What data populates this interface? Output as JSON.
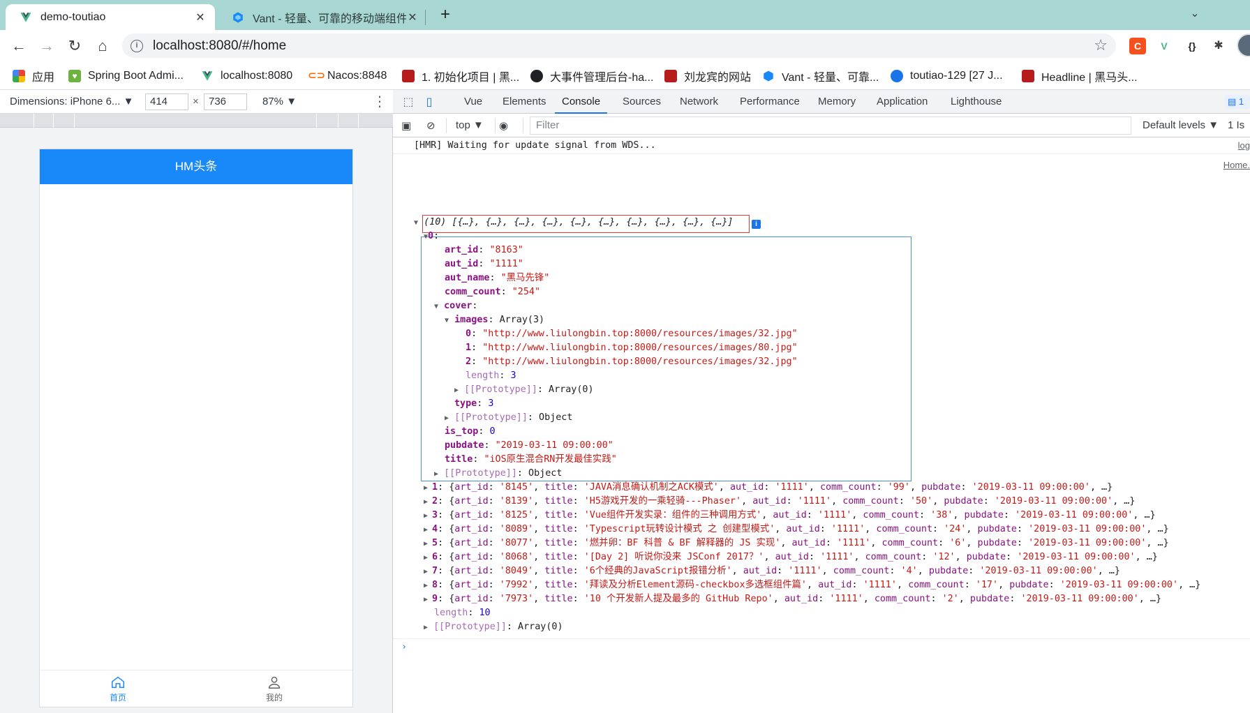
{
  "browser": {
    "tabs": [
      {
        "title": "demo-toutiao",
        "active": true
      },
      {
        "title": "Vant - 轻量、可靠的移动端组件库",
        "active": false
      }
    ],
    "url": "localhost:8080/#/home",
    "bookmarks": [
      {
        "label": "应用",
        "icon": "apps-grid-icon"
      },
      {
        "label": "Spring Boot Admi...",
        "icon": "spring-boot-icon"
      },
      {
        "label": "localhost:8080",
        "icon": "vue-icon"
      },
      {
        "label": "Nacos:8848",
        "icon": "nacos-icon"
      },
      {
        "label": "1. 初始化项目 | 黑...",
        "icon": "heima-icon"
      },
      {
        "label": "大事件管理后台-ha...",
        "icon": "github-icon"
      },
      {
        "label": "刘龙宾的网站",
        "icon": "heima-icon"
      },
      {
        "label": "Vant - 轻量、可靠...",
        "icon": "vant-icon"
      },
      {
        "label": "toutiao-129 [27 J...",
        "icon": "globe-icon"
      },
      {
        "label": "Headline | 黑马头...",
        "icon": "heima-icon"
      }
    ]
  },
  "device": {
    "name": "Dimensions: iPhone 6...",
    "width": "414",
    "height": "736",
    "zoom": "87%",
    "app": {
      "nav_title": "HM头条",
      "tabbar": [
        {
          "label": "首页",
          "icon": "home-icon",
          "active": true
        },
        {
          "label": "我的",
          "icon": "user-icon",
          "active": false
        }
      ]
    }
  },
  "devtools": {
    "tabs": [
      "Vue",
      "Elements",
      "Console",
      "Sources",
      "Network",
      "Performance",
      "Memory",
      "Application",
      "Lighthouse"
    ],
    "active_tab": "Console",
    "issues_count": "1",
    "context": "top",
    "filter_placeholder": "Filter",
    "levels": "Default levels",
    "issues_right": "1 Is",
    "console": {
      "hmr_message": "[HMR] Waiting for update signal from WDS...",
      "hmr_source": "log",
      "array_source": "Home.",
      "array_summary": "(10) [{…}, {…}, {…}, {…}, {…}, {…}, {…}, {…}, {…}, {…}]",
      "item0": {
        "art_id": "\"8163\"",
        "aut_id": "\"1111\"",
        "aut_name": "\"黑马先锋\"",
        "comm_count": "\"254\"",
        "images_summary": "Array(3)",
        "images": [
          "\"http://www.liulongbin.top:8000/resources/images/32.jpg\"",
          "\"http://www.liulongbin.top:8000/resources/images/80.jpg\"",
          "\"http://www.liulongbin.top:8000/resources/images/32.jpg\""
        ],
        "images_length": "3",
        "images_proto": "Array(0)",
        "cover_type": "3",
        "cover_proto": "Object",
        "is_top": "0",
        "pubdate": "\"2019-03-11 09:00:00\"",
        "title": "\"iOS原生混合RN开发最佳实践\"",
        "proto": "Object"
      },
      "rows": [
        {
          "idx": "1",
          "art_id": "'8145'",
          "title": "'JAVA消息确认机制之ACK模式'",
          "aut_id": "'1111'",
          "comm_count": "'99'",
          "pubdate": "'2019-03-11 09:00:00'"
        },
        {
          "idx": "2",
          "art_id": "'8139'",
          "title": "'H5游戏开发的一乘轻骑---Phaser'",
          "aut_id": "'1111'",
          "comm_count": "'50'",
          "pubdate": "'2019-03-11 09:00:00'"
        },
        {
          "idx": "3",
          "art_id": "'8125'",
          "title": "'Vue组件开发实录：组件的三种调用方式'",
          "aut_id": "'1111'",
          "comm_count": "'38'",
          "pubdate": "'2019-03-11 09:00:00'"
        },
        {
          "idx": "4",
          "art_id": "'8089'",
          "title": "'Typescript玩转设计模式 之 创建型模式'",
          "aut_id": "'1111'",
          "comm_count": "'24'",
          "pubdate": "'2019-03-11 09:00:00'"
        },
        {
          "idx": "5",
          "art_id": "'8077'",
          "title": "'燃并卵：BF 科普 & BF 解释器的 JS 实现'",
          "aut_id": "'1111'",
          "comm_count": "'6'",
          "pubdate": "'2019-03-11 09:00:00'"
        },
        {
          "idx": "6",
          "art_id": "'8068'",
          "title": "'[Day 2] 听说你没来 JSConf 2017？'",
          "aut_id": "'1111'",
          "comm_count": "'12'",
          "pubdate": "'2019-03-11 09:00:00'"
        },
        {
          "idx": "7",
          "art_id": "'8049'",
          "title": "'6个经典的JavaScript报错分析'",
          "aut_id": "'1111'",
          "comm_count": "'4'",
          "pubdate": "'2019-03-11 09:00:00'"
        },
        {
          "idx": "8",
          "art_id": "'7992'",
          "title": "'拜读及分析Element源码-checkbox多选框组件篇'",
          "aut_id": "'1111'",
          "comm_count": "'17'",
          "pubdate": "'2019-03-11 09:00:00'"
        },
        {
          "idx": "9",
          "art_id": "'7973'",
          "title": "'10 个开发新人提及最多的 GitHub Repo'",
          "aut_id": "'1111'",
          "comm_count": "'2'",
          "pubdate": "'2019-03-11 09:00:00'"
        }
      ],
      "length": "10",
      "array_proto": "Array(0)"
    }
  }
}
